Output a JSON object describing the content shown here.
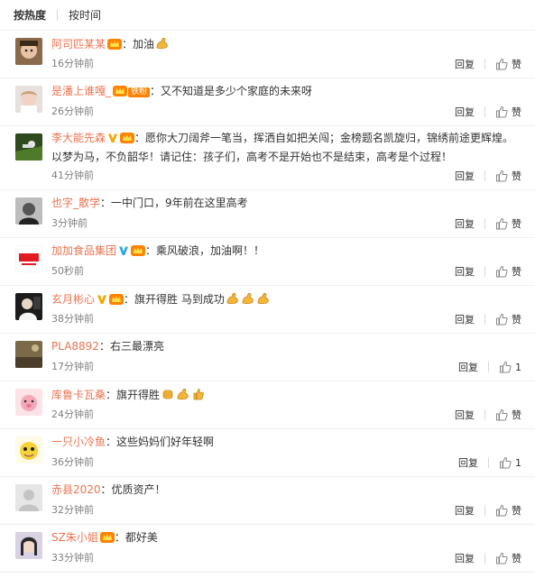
{
  "tabs": [
    {
      "label": "按热度",
      "active": true
    },
    {
      "label": "按时间",
      "active": false
    }
  ],
  "reply_label": "回复",
  "like_label": "赞",
  "comments": [
    {
      "user": "阿司匹某某",
      "text": "：加油",
      "time": "16分钟前",
      "likes": "",
      "emoji": [
        "flex-arm-emoji"
      ]
    },
    {
      "user": "是潘上谁嘎_",
      "fan_tag": "铁粉",
      "text": "：又不知道是多少个家庭的未来呀",
      "time": "26分钟前",
      "likes": ""
    },
    {
      "user": "李大能先森",
      "verified": true,
      "text": "：愿你大刀阔斧一笔当，挥洒自如把关闯；金榜题名凯旋归，锦绣前途更辉煌。以梦为马，不负韶华！请记住：孩子们，高考不是开始也不是结束，高考是个过程！",
      "time": "41分钟前",
      "likes": ""
    },
    {
      "user": "也字_散学",
      "text": "：一中门口，9年前在这里高考",
      "time": "3分钟前",
      "likes": ""
    },
    {
      "user": "加加食品集团",
      "verified_blue": true,
      "text": "：乘风破浪，加油啊！！",
      "time": "50秒前",
      "likes": ""
    },
    {
      "user": "玄月彬心",
      "verified": true,
      "text": "：旗开得胜 马到成功",
      "time": "38分钟前",
      "likes": "",
      "emoji": [
        "flex-arm-emoji",
        "flex-arm-emoji",
        "flex-arm-emoji"
      ]
    },
    {
      "user": "PLA8892",
      "text": "：右三最漂亮",
      "time": "17分钟前",
      "likes": "1"
    },
    {
      "user": "库鲁卡瓦桑",
      "text": "：旗开得胜",
      "time": "24分钟前",
      "likes": "",
      "emoji": [
        "fist-emoji",
        "flex-arm-emoji",
        "thumbs-up-emoji"
      ]
    },
    {
      "user": "一只小冷鱼",
      "text": "：这些妈妈们好年轻啊",
      "time": "36分钟前",
      "likes": "1"
    },
    {
      "user": "赤县2020",
      "text": "：优质资产！",
      "time": "32分钟前",
      "likes": ""
    },
    {
      "user": "SZ朱小姐",
      "text": "：都好美",
      "time": "33分钟前",
      "likes": ""
    }
  ],
  "colors": {
    "username": "#eb7350",
    "time": "#808080",
    "fan_tag": "#ff8200"
  }
}
